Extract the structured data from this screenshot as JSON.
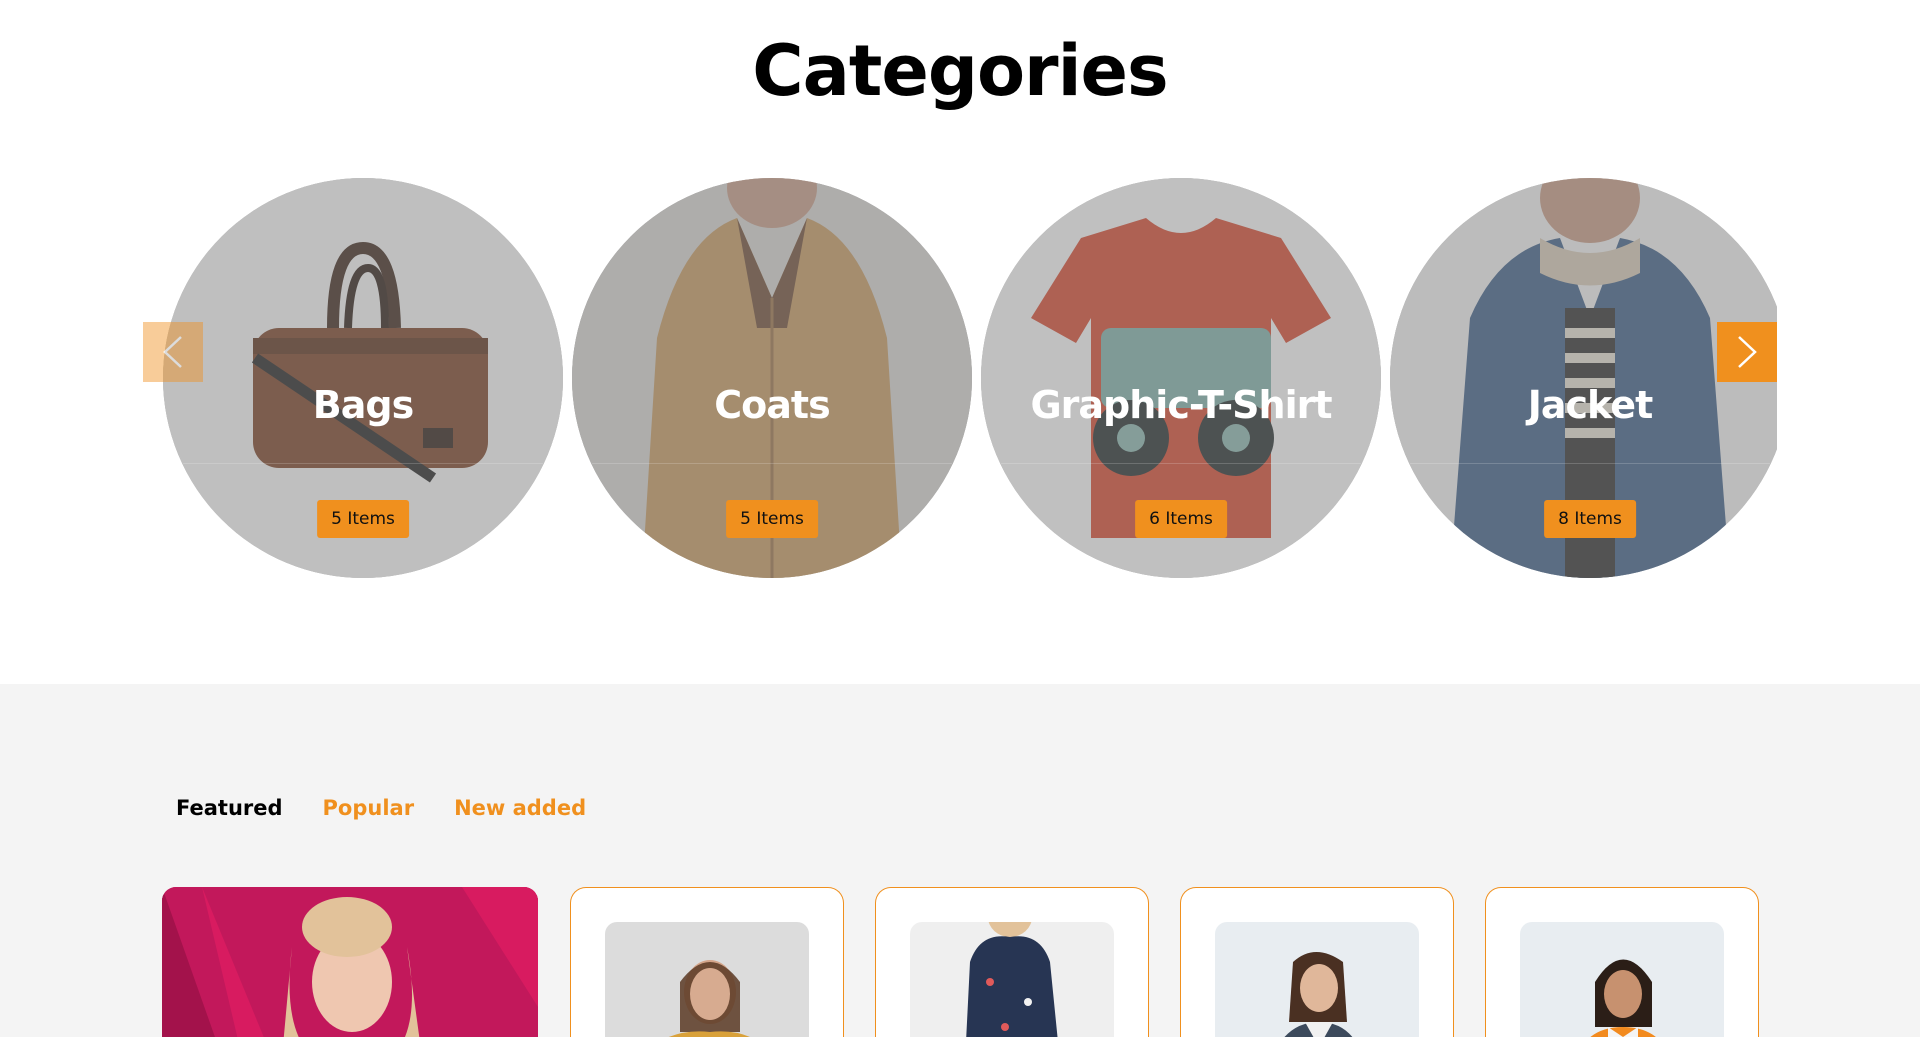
{
  "categories": {
    "title": "Categories",
    "items": [
      {
        "name": "Bags",
        "count": "5 Items",
        "image": "bag-image"
      },
      {
        "name": "Coats",
        "count": "5 Items",
        "image": "coat-image"
      },
      {
        "name": "Graphic-T-Shirt",
        "count": "6 Items",
        "image": "tshirt-image"
      },
      {
        "name": "Jacket",
        "count": "8 Items",
        "image": "jacket-image"
      }
    ],
    "prev_icon": "chevron-left-icon",
    "next_icon": "chevron-right-icon"
  },
  "products": {
    "tabs": [
      {
        "label": "Featured",
        "active": true
      },
      {
        "label": "Popular",
        "active": false
      },
      {
        "label": "New added",
        "active": false
      }
    ]
  },
  "colors": {
    "accent": "#f0901e",
    "section_bg": "#f4f4f4",
    "overlay": "#808080"
  }
}
